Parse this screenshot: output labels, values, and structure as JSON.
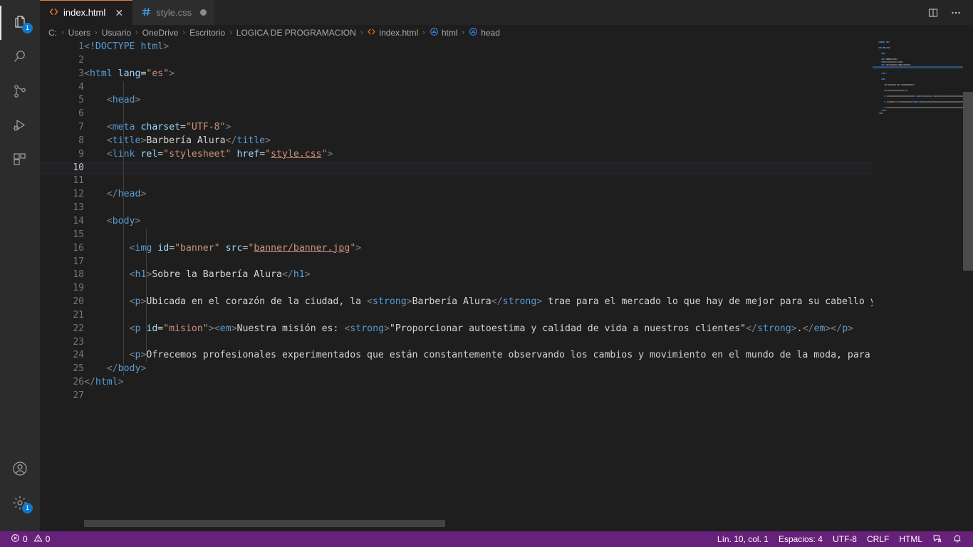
{
  "activity_bar": {
    "top_items": [
      {
        "name": "explorer",
        "icon": "files-icon",
        "badge": "1",
        "active": true
      },
      {
        "name": "search",
        "icon": "search-icon",
        "badge": "",
        "active": false
      },
      {
        "name": "source-control",
        "icon": "source-control-icon",
        "badge": "",
        "active": false
      },
      {
        "name": "run-and-debug",
        "icon": "run-debug-icon",
        "badge": "",
        "active": false
      },
      {
        "name": "extensions",
        "icon": "extensions-icon",
        "badge": "",
        "active": false
      }
    ],
    "bottom_items": [
      {
        "name": "accounts",
        "icon": "account-icon",
        "badge": ""
      },
      {
        "name": "manage-settings",
        "icon": "gear-icon",
        "badge": "1"
      }
    ]
  },
  "tabs": [
    {
      "label": "index.html",
      "icon": "html-file-icon",
      "active": true,
      "dirty": false,
      "close_glyph": "✕"
    },
    {
      "label": "style.css",
      "icon": "css-file-icon",
      "active": false,
      "dirty": true,
      "close_glyph": "✕"
    }
  ],
  "tabbar_actions": [
    {
      "name": "split-editor-right",
      "icon": "split-editor-icon"
    },
    {
      "name": "more-actions",
      "icon": "ellipsis-icon",
      "glyph": "⋯"
    }
  ],
  "breadcrumbs": {
    "separator": "›",
    "items": [
      {
        "label": "C:",
        "icon": ""
      },
      {
        "label": "Users",
        "icon": ""
      },
      {
        "label": "Usuario",
        "icon": ""
      },
      {
        "label": "OneDrive",
        "icon": ""
      },
      {
        "label": "Escritorio",
        "icon": ""
      },
      {
        "label": "LOGICA DE PROGRAMACION",
        "icon": ""
      },
      {
        "label": "index.html",
        "icon": "html-file-icon"
      },
      {
        "label": "html",
        "icon": "symbol-field-icon"
      },
      {
        "label": "head",
        "icon": "symbol-field-icon"
      }
    ]
  },
  "editor": {
    "language": "HTML",
    "current_line": 10,
    "total_lines": 27,
    "lines": [
      {
        "n": 1,
        "indent": 0,
        "tokens": [
          {
            "t": "brk",
            "v": "<"
          },
          {
            "t": "doctype",
            "v": "!DOCTYPE"
          },
          {
            "t": "txt",
            "v": " "
          },
          {
            "t": "tag",
            "v": "html"
          },
          {
            "t": "brk",
            "v": ">"
          }
        ]
      },
      {
        "n": 2,
        "indent": 0,
        "tokens": []
      },
      {
        "n": 3,
        "indent": 0,
        "tokens": [
          {
            "t": "brk",
            "v": "<"
          },
          {
            "t": "tag",
            "v": "html"
          },
          {
            "t": "txt",
            "v": " "
          },
          {
            "t": "attr",
            "v": "lang"
          },
          {
            "t": "eq",
            "v": "="
          },
          {
            "t": "str",
            "v": "\"es\""
          },
          {
            "t": "brk",
            "v": ">"
          }
        ]
      },
      {
        "n": 4,
        "indent": 1,
        "tokens": []
      },
      {
        "n": 5,
        "indent": 1,
        "tokens": [
          {
            "t": "txt",
            "v": "    "
          },
          {
            "t": "brk",
            "v": "<"
          },
          {
            "t": "tag",
            "v": "head"
          },
          {
            "t": "brk",
            "v": ">"
          }
        ]
      },
      {
        "n": 6,
        "indent": 1,
        "tokens": []
      },
      {
        "n": 7,
        "indent": 1,
        "tokens": [
          {
            "t": "txt",
            "v": "    "
          },
          {
            "t": "brk",
            "v": "<"
          },
          {
            "t": "tag",
            "v": "meta"
          },
          {
            "t": "txt",
            "v": " "
          },
          {
            "t": "attr",
            "v": "charset"
          },
          {
            "t": "eq",
            "v": "="
          },
          {
            "t": "str",
            "v": "\"UTF-8\""
          },
          {
            "t": "brk",
            "v": ">"
          }
        ]
      },
      {
        "n": 8,
        "indent": 1,
        "tokens": [
          {
            "t": "txt",
            "v": "    "
          },
          {
            "t": "brk",
            "v": "<"
          },
          {
            "t": "tag",
            "v": "title"
          },
          {
            "t": "brk",
            "v": ">"
          },
          {
            "t": "txt",
            "v": "Barbería Alura"
          },
          {
            "t": "brk",
            "v": "</"
          },
          {
            "t": "tag",
            "v": "title"
          },
          {
            "t": "brk",
            "v": ">"
          }
        ]
      },
      {
        "n": 9,
        "indent": 1,
        "tokens": [
          {
            "t": "txt",
            "v": "    "
          },
          {
            "t": "brk",
            "v": "<"
          },
          {
            "t": "tag",
            "v": "link"
          },
          {
            "t": "txt",
            "v": " "
          },
          {
            "t": "attr",
            "v": "rel"
          },
          {
            "t": "eq",
            "v": "="
          },
          {
            "t": "str",
            "v": "\"stylesheet\""
          },
          {
            "t": "txt",
            "v": " "
          },
          {
            "t": "attr",
            "v": "href"
          },
          {
            "t": "eq",
            "v": "="
          },
          {
            "t": "str",
            "v": "\""
          },
          {
            "t": "link",
            "v": "style.css"
          },
          {
            "t": "str",
            "v": "\""
          },
          {
            "t": "brk",
            "v": ">"
          }
        ]
      },
      {
        "n": 10,
        "indent": 1,
        "tokens": []
      },
      {
        "n": 11,
        "indent": 1,
        "tokens": []
      },
      {
        "n": 12,
        "indent": 1,
        "tokens": [
          {
            "t": "txt",
            "v": "    "
          },
          {
            "t": "brk",
            "v": "</"
          },
          {
            "t": "tag",
            "v": "head"
          },
          {
            "t": "brk",
            "v": ">"
          }
        ]
      },
      {
        "n": 13,
        "indent": 1,
        "tokens": []
      },
      {
        "n": 14,
        "indent": 1,
        "tokens": [
          {
            "t": "txt",
            "v": "    "
          },
          {
            "t": "brk",
            "v": "<"
          },
          {
            "t": "tag",
            "v": "body"
          },
          {
            "t": "brk",
            "v": ">"
          }
        ]
      },
      {
        "n": 15,
        "indent": 2,
        "tokens": []
      },
      {
        "n": 16,
        "indent": 2,
        "tokens": [
          {
            "t": "txt",
            "v": "        "
          },
          {
            "t": "brk",
            "v": "<"
          },
          {
            "t": "tag",
            "v": "img"
          },
          {
            "t": "txt",
            "v": " "
          },
          {
            "t": "attr",
            "v": "id"
          },
          {
            "t": "eq",
            "v": "="
          },
          {
            "t": "str",
            "v": "\"banner\""
          },
          {
            "t": "txt",
            "v": " "
          },
          {
            "t": "attr",
            "v": "src"
          },
          {
            "t": "eq",
            "v": "="
          },
          {
            "t": "str",
            "v": "\""
          },
          {
            "t": "link",
            "v": "banner/banner.jpg"
          },
          {
            "t": "str",
            "v": "\""
          },
          {
            "t": "brk",
            "v": ">"
          }
        ]
      },
      {
        "n": 17,
        "indent": 2,
        "tokens": []
      },
      {
        "n": 18,
        "indent": 2,
        "tokens": [
          {
            "t": "txt",
            "v": "        "
          },
          {
            "t": "brk",
            "v": "<"
          },
          {
            "t": "tag",
            "v": "h1"
          },
          {
            "t": "brk",
            "v": ">"
          },
          {
            "t": "txt",
            "v": "Sobre la Barbería Alura"
          },
          {
            "t": "brk",
            "v": "</"
          },
          {
            "t": "tag",
            "v": "h1"
          },
          {
            "t": "brk",
            "v": ">"
          }
        ]
      },
      {
        "n": 19,
        "indent": 2,
        "tokens": []
      },
      {
        "n": 20,
        "indent": 2,
        "tokens": [
          {
            "t": "txt",
            "v": "        "
          },
          {
            "t": "brk",
            "v": "<"
          },
          {
            "t": "tag",
            "v": "p"
          },
          {
            "t": "brk",
            "v": ">"
          },
          {
            "t": "txt",
            "v": "Ubicada en el corazón de la ciudad, la "
          },
          {
            "t": "brk",
            "v": "<"
          },
          {
            "t": "tag",
            "v": "strong"
          },
          {
            "t": "brk",
            "v": ">"
          },
          {
            "t": "txt",
            "v": "Barbería Alura"
          },
          {
            "t": "brk",
            "v": "</"
          },
          {
            "t": "tag",
            "v": "strong"
          },
          {
            "t": "brk",
            "v": ">"
          },
          {
            "t": "txt",
            "v": " trae para el mercado lo que hay de mejor para su cabello y barb"
          }
        ]
      },
      {
        "n": 21,
        "indent": 2,
        "tokens": []
      },
      {
        "n": 22,
        "indent": 2,
        "tokens": [
          {
            "t": "txt",
            "v": "        "
          },
          {
            "t": "brk",
            "v": "<"
          },
          {
            "t": "tag",
            "v": "p"
          },
          {
            "t": "txt",
            "v": " "
          },
          {
            "t": "attr",
            "v": "id"
          },
          {
            "t": "eq",
            "v": "="
          },
          {
            "t": "str",
            "v": "\"mision\""
          },
          {
            "t": "brk",
            "v": ">"
          },
          {
            "t": "brk",
            "v": "<"
          },
          {
            "t": "tag",
            "v": "em"
          },
          {
            "t": "brk",
            "v": ">"
          },
          {
            "t": "txt",
            "v": "Nuestra misión es: "
          },
          {
            "t": "brk",
            "v": "<"
          },
          {
            "t": "tag",
            "v": "strong"
          },
          {
            "t": "brk",
            "v": ">"
          },
          {
            "t": "txt",
            "v": "\"Proporcionar autoestima y calidad de vida a nuestros clientes\""
          },
          {
            "t": "brk",
            "v": "</"
          },
          {
            "t": "tag",
            "v": "strong"
          },
          {
            "t": "brk",
            "v": ">"
          },
          {
            "t": "txt",
            "v": "."
          },
          {
            "t": "brk",
            "v": "</"
          },
          {
            "t": "tag",
            "v": "em"
          },
          {
            "t": "brk",
            "v": ">"
          },
          {
            "t": "brk",
            "v": "</"
          },
          {
            "t": "tag",
            "v": "p"
          },
          {
            "t": "brk",
            "v": ">"
          }
        ]
      },
      {
        "n": 23,
        "indent": 2,
        "tokens": []
      },
      {
        "n": 24,
        "indent": 2,
        "tokens": [
          {
            "t": "txt",
            "v": "        "
          },
          {
            "t": "brk",
            "v": "<"
          },
          {
            "t": "tag",
            "v": "p"
          },
          {
            "t": "brk",
            "v": ">"
          },
          {
            "t": "txt",
            "v": "Ofrecemos profesionales experimentados que están constantemente observando los cambios y movimiento en el mundo de la moda, para así o"
          }
        ]
      },
      {
        "n": 25,
        "indent": 1,
        "tokens": [
          {
            "t": "txt",
            "v": "    "
          },
          {
            "t": "brk",
            "v": "</"
          },
          {
            "t": "tag",
            "v": "body"
          },
          {
            "t": "brk",
            "v": ">"
          }
        ]
      },
      {
        "n": 26,
        "indent": 0,
        "tokens": [
          {
            "t": "brk",
            "v": "</"
          },
          {
            "t": "tag",
            "v": "html"
          },
          {
            "t": "brk",
            "v": ">"
          }
        ]
      },
      {
        "n": 27,
        "indent": 0,
        "tokens": []
      }
    ]
  },
  "status_bar": {
    "left": [
      {
        "name": "problems",
        "icon": "error-icon",
        "label": "0",
        "icon2": "warning-icon",
        "label2": "0"
      }
    ],
    "errors": "0",
    "warnings": "0",
    "right": [
      {
        "name": "editor-position",
        "label": "Lín. 10, col. 1"
      },
      {
        "name": "indentation",
        "label": "Espacios: 4"
      },
      {
        "name": "encoding",
        "label": "UTF-8"
      },
      {
        "name": "eol",
        "label": "CRLF"
      },
      {
        "name": "language-mode",
        "label": "HTML"
      }
    ],
    "right_icons": [
      {
        "name": "live-share-icon"
      },
      {
        "name": "notifications-bell-icon"
      }
    ]
  },
  "colors": {
    "status_bar_bg": "#68217a",
    "activity_bar_bg": "#2c2c2c",
    "tab_bar_bg": "#252526",
    "editor_bg": "#1e1e1e",
    "active_tab_border": "#e07a3e",
    "badge_bg": "#0a7aca",
    "tag_color": "#569cd6",
    "attr_color": "#9cdcfe",
    "string_color": "#ce9178",
    "text_color": "#d4d4d4"
  }
}
